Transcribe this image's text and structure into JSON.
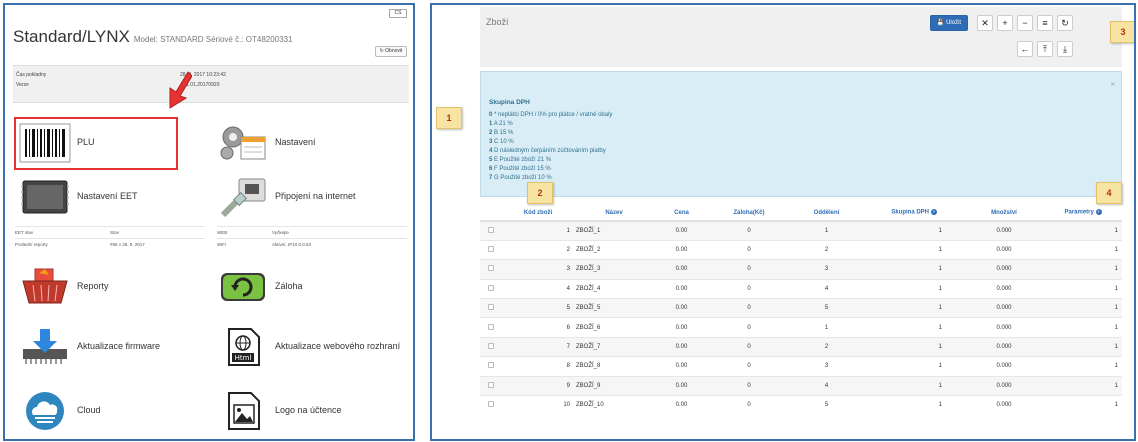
{
  "left": {
    "lang": "CS",
    "brand": "Standard/LYNX",
    "model": "Model: STANDARD Sériové č.: OT48200331",
    "refresh_label": "Obnovit",
    "info": [
      {
        "label": "Čas pokladny",
        "value": "28. 9. 2017 10:23:42"
      },
      {
        "label": "Verze",
        "value": "A01.01.20170929"
      }
    ],
    "tiles": [
      {
        "label": "PLU",
        "icon": "barcode-icon"
      },
      {
        "label": "Nastavení",
        "icon": "settings-gears-icon"
      },
      {
        "label": "Nastavení EET",
        "icon": "chip-icon"
      },
      {
        "label": "Připojení na internet",
        "icon": "network-cable-icon"
      },
      {
        "label": "Reporty",
        "icon": "shopping-basket-icon"
      },
      {
        "label": "Záloha",
        "icon": "backup-drive-icon"
      },
      {
        "label": "Aktualizace firmware",
        "icon": "firmware-download-icon"
      },
      {
        "label": "Aktualizace webového rozhraní",
        "icon": "html-file-icon"
      },
      {
        "label": "Cloud",
        "icon": "cloud-icon"
      },
      {
        "label": "Logo na účtence",
        "icon": "image-file-icon"
      }
    ],
    "status_left": {
      "h1": "EET stav",
      "h2": "Stav",
      "r1": "Poslední reporty",
      "r2": "#55 v 28. 9. 2017"
    },
    "status_right": {
      "h1": "WEB",
      "h2": "Vyčkejte",
      "r1": "WiFi",
      "r2": "Aktivní, IP10.0.0.53"
    }
  },
  "right": {
    "title": "Zboží",
    "save_label": "Uložit",
    "toolbar": [
      "close-icon",
      "plus-icon",
      "minus-icon",
      "list-icon",
      "refresh-icon"
    ],
    "toolbar2": [
      "arrow-left-icon",
      "upload-icon",
      "download-icon"
    ],
    "callouts": [
      "1",
      "2",
      "3",
      "4"
    ],
    "dph": {
      "title": "Skupina DPH",
      "lines": [
        {
          "n": "0",
          "t": "* neplátci DPH / 0% pro plátce / vratné obaly"
        },
        {
          "n": "1",
          "t": "A 21 %"
        },
        {
          "n": "2",
          "t": "B 15 %"
        },
        {
          "n": "3",
          "t": "C 10 %"
        },
        {
          "n": "4",
          "t": "D následným čerpáním zúčtováním platby"
        },
        {
          "n": "5",
          "t": "E Použité zboží 21 %"
        },
        {
          "n": "6",
          "t": "F Použité zboží 15 %"
        },
        {
          "n": "7",
          "t": "G Použité zboží 10 %"
        }
      ]
    },
    "columns": [
      "Kód zboží",
      "Název",
      "Cena",
      "Záloha(Kč)",
      "Oddělení",
      "Skupina DPH",
      "Množství",
      "Parametry"
    ],
    "rows": [
      {
        "kod": "1",
        "nazev": "ZBOŽÍ_1",
        "cena": "0.00",
        "zaloha": "0",
        "odd": "1",
        "dph": "1",
        "mnoz": "0.000",
        "par": "1"
      },
      {
        "kod": "2",
        "nazev": "ZBOŽÍ_2",
        "cena": "0.00",
        "zaloha": "0",
        "odd": "2",
        "dph": "1",
        "mnoz": "0.000",
        "par": "1"
      },
      {
        "kod": "3",
        "nazev": "ZBOŽÍ_3",
        "cena": "0.00",
        "zaloha": "0",
        "odd": "3",
        "dph": "1",
        "mnoz": "0.000",
        "par": "1"
      },
      {
        "kod": "4",
        "nazev": "ZBOŽÍ_4",
        "cena": "0.00",
        "zaloha": "0",
        "odd": "4",
        "dph": "1",
        "mnoz": "0.000",
        "par": "1"
      },
      {
        "kod": "5",
        "nazev": "ZBOŽÍ_5",
        "cena": "0.00",
        "zaloha": "0",
        "odd": "5",
        "dph": "1",
        "mnoz": "0.000",
        "par": "1"
      },
      {
        "kod": "6",
        "nazev": "ZBOŽÍ_6",
        "cena": "0.00",
        "zaloha": "0",
        "odd": "1",
        "dph": "1",
        "mnoz": "0.000",
        "par": "1"
      },
      {
        "kod": "7",
        "nazev": "ZBOŽÍ_7",
        "cena": "0.00",
        "zaloha": "0",
        "odd": "2",
        "dph": "1",
        "mnoz": "0.000",
        "par": "1"
      },
      {
        "kod": "8",
        "nazev": "ZBOŽÍ_8",
        "cena": "0.00",
        "zaloha": "0",
        "odd": "3",
        "dph": "1",
        "mnoz": "0.000",
        "par": "1"
      },
      {
        "kod": "9",
        "nazev": "ZBOŽÍ_9",
        "cena": "0.00",
        "zaloha": "0",
        "odd": "4",
        "dph": "1",
        "mnoz": "0.000",
        "par": "1"
      },
      {
        "kod": "10",
        "nazev": "ZBOŽÍ_10",
        "cena": "0.00",
        "zaloha": "0",
        "odd": "5",
        "dph": "1",
        "mnoz": "0.000",
        "par": "1"
      }
    ]
  },
  "colors": {
    "panel_border": "#3a6fb0",
    "accent": "#2e6db6",
    "alert_bg": "#d9edf7",
    "plu_highlight": "#e53333",
    "callout_bg": "#f7e4a2"
  }
}
